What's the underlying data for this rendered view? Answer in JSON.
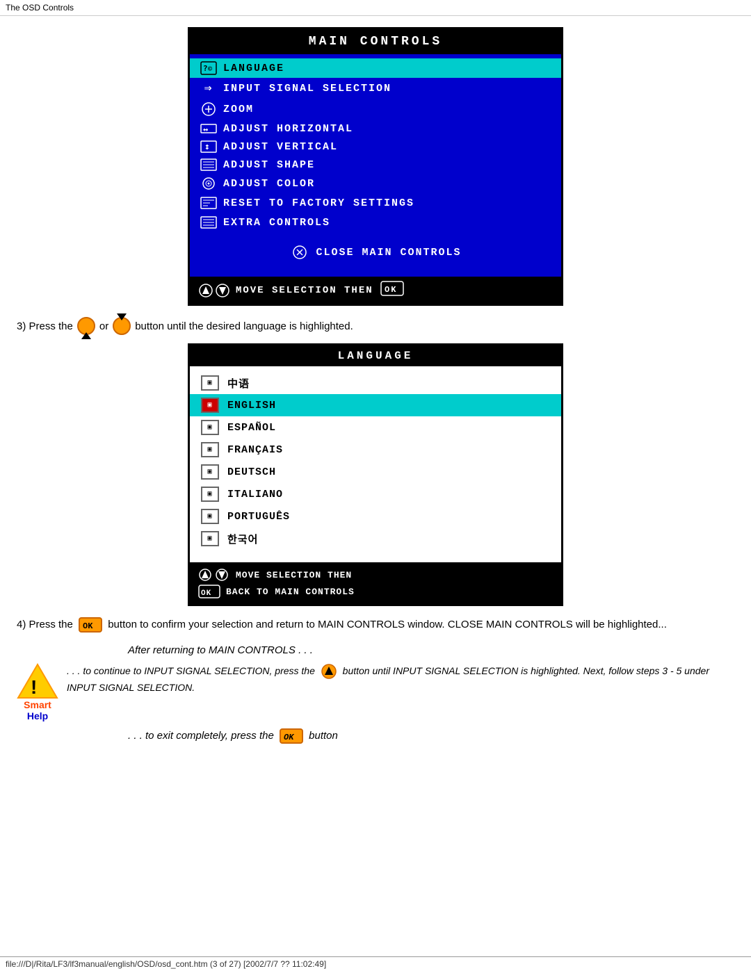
{
  "topbar": {
    "label": "The OSD Controls"
  },
  "mainControls": {
    "title": "MAIN  CONTROLS",
    "items": [
      {
        "icon": "🔤",
        "label": "LANGUAGE",
        "highlighted": true
      },
      {
        "icon": "⇒",
        "label": "INPUT  SIGNAL  SELECTION",
        "highlighted": false
      },
      {
        "icon": "⊕",
        "label": "ZOOM",
        "highlighted": false
      },
      {
        "icon": "↔",
        "label": "ADJUST  HORIZONTAL",
        "highlighted": false
      },
      {
        "icon": "↕",
        "label": "ADJUST  VERTICAL",
        "highlighted": false
      },
      {
        "icon": "▤",
        "label": "ADJUST  SHAPE",
        "highlighted": false
      },
      {
        "icon": "◎",
        "label": "ADJUST  COLOR",
        "highlighted": false
      },
      {
        "icon": "▥",
        "label": "RESET  TO  FACTORY  SETTINGS",
        "highlighted": false
      },
      {
        "icon": "☰",
        "label": "EXTRA  CONTROLS",
        "highlighted": false
      }
    ],
    "closeLabel": "CLOSE  MAIN  CONTROLS",
    "footerLabel": "MOVE  SELECTION  THEN"
  },
  "instruction3": {
    "text1": "3) Press the",
    "text2": "or",
    "text3": "button until the desired language is highlighted."
  },
  "languageMenu": {
    "title": "LANGUAGE",
    "items": [
      {
        "label": "中语",
        "highlighted": false
      },
      {
        "label": "ENGLISH",
        "highlighted": true
      },
      {
        "label": "ESPAÑOL",
        "highlighted": false
      },
      {
        "label": "FRANÇAIS",
        "highlighted": false
      },
      {
        "label": "DEUTSCH",
        "highlighted": false
      },
      {
        "label": "ITALIANO",
        "highlighted": false
      },
      {
        "label": "PORTUGUÊS",
        "highlighted": false
      },
      {
        "label": "한국어",
        "highlighted": false
      }
    ],
    "footer1": "MOVE SELECTION THEN",
    "footer2": "BACK TO MAIN CONTROLS"
  },
  "instruction4": {
    "text": "4) Press the",
    "text2": "button to confirm your selection and return to MAIN CONTROLS window. CLOSE MAIN CONTROLS will be highlighted..."
  },
  "smartHelp": {
    "afterReturning": "After returning to MAIN CONTROLS . . .",
    "smartLabel": "Smart",
    "helpLabel": "Help",
    "text1": ". . . to continue to INPUT SIGNAL SELECTION, press the",
    "text2": "button until INPUT SIGNAL SELECTION is highlighted. Next, follow steps 3 - 5 under INPUT SIGNAL SELECTION.",
    "exitText": ". . . to exit completely, press the",
    "exitText2": "button"
  },
  "bottomBar": {
    "label": "file:///D|/Rita/LF3/lf3manual/english/OSD/osd_cont.htm (3 of 27) [2002/7/7 ?? 11:02:49]"
  }
}
